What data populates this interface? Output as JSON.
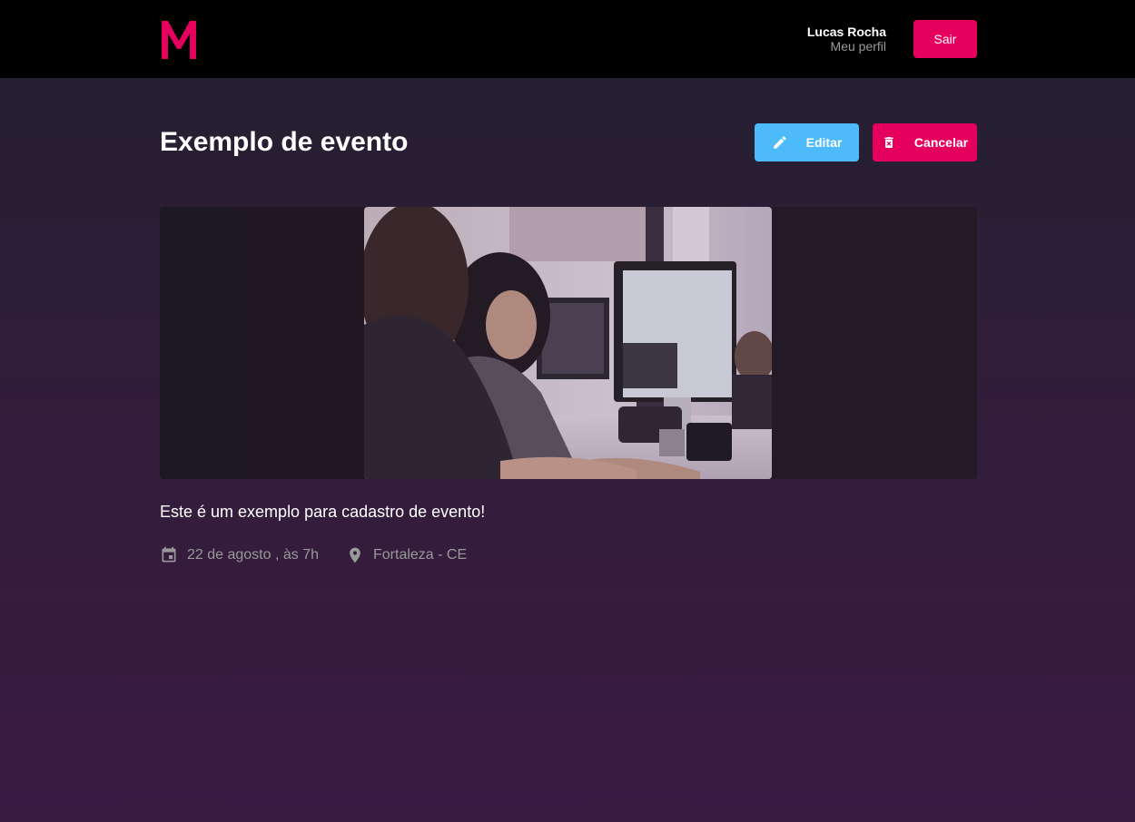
{
  "header": {
    "logo": "M",
    "user_name": "Lucas Rocha",
    "profile_link": "Meu perfil",
    "logout_label": "Sair"
  },
  "event": {
    "title": "Exemplo de evento",
    "edit_label": "Editar",
    "cancel_label": "Cancelar",
    "banner_icon": "photo-of-women-at-computers",
    "description": "Este é um exemplo para cadastro de evento!",
    "date": "22 de agosto , às 7h",
    "location": "Fortaleza - CE"
  },
  "colors": {
    "accent": "#e5005d",
    "edit": "#4dbaf9",
    "header_bg": "#000000",
    "muted_text": "#999999"
  }
}
